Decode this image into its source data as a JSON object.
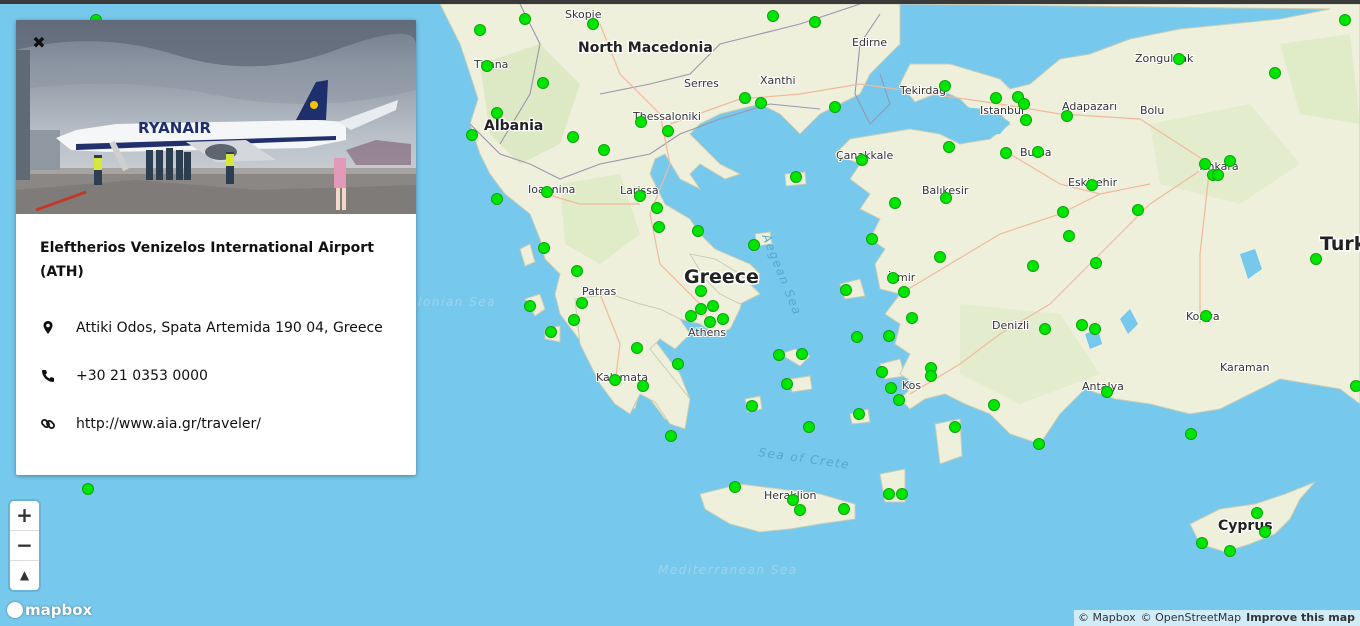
{
  "popup": {
    "close_icon": "close-icon",
    "name": "Eleftherios Venizelos International Airport (ATH)",
    "address": "Attiki Odos, Spata Artemida 190 04, Greece",
    "phone": "+30 21 0353 0000",
    "website": "http://www.aia.gr/traveler/",
    "photo_text": "RYANAIR"
  },
  "map": {
    "countries": [
      "Greece",
      "Albania",
      "North Macedonia",
      "Cyprus",
      "Turk"
    ],
    "places": [
      "Skopje",
      "Tirana",
      "Edirne",
      "Serres",
      "Xanthi",
      "Thessaloniki",
      "Tekirdağ",
      "Istanbul",
      "Adapazarı",
      "Zonguldak",
      "Bolu",
      "Ankara",
      "Çanakkale",
      "Bursa",
      "Eskişehir",
      "Balıkesir",
      "Ioannina",
      "Larissa",
      "Patras",
      "Athens",
      "İzmir",
      "Denizli",
      "Konya",
      "Karaman",
      "Kalamata",
      "Kos",
      "Antalya",
      "Heraklion"
    ],
    "seas": [
      "Aegean Sea",
      "Sea of Crete",
      "Mediterranean Sea",
      "Ionian Sea"
    ],
    "marker_color": "#00e600",
    "water_color": "#76c8ec",
    "land_color": "#eef0dc"
  },
  "controls": {
    "zoom_in": "+",
    "zoom_out": "−",
    "compass": "▲"
  },
  "logo": "mapbox",
  "attribution": {
    "mapbox": "© Mapbox",
    "osm": "© OpenStreetMap",
    "improve": "Improve this map"
  }
}
